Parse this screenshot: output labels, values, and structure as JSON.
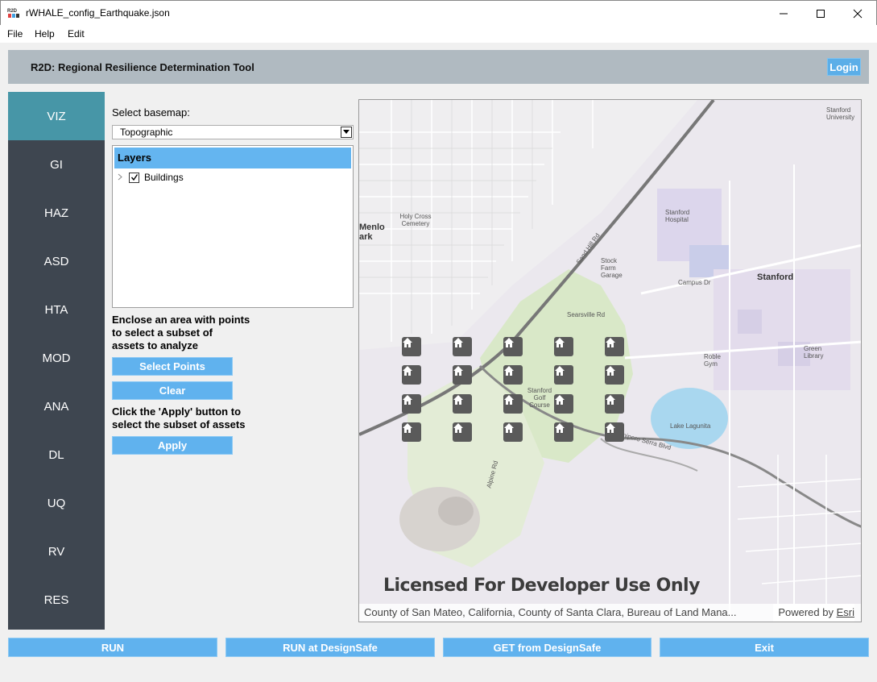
{
  "window": {
    "title": "rWHALE_config_Earthquake.json",
    "app_icon": "r2d-app-icon",
    "minimize_icon": "minimize-icon",
    "maximize_icon": "maximize-icon",
    "close_icon": "close-icon"
  },
  "menu": {
    "items": [
      "File",
      "Help",
      "Edit"
    ]
  },
  "header": {
    "title": "R2D: Regional Resilience Determination Tool",
    "login_label": "Login"
  },
  "sidebar": {
    "items": [
      {
        "label": "VIZ",
        "active": true
      },
      {
        "label": "GI",
        "active": false
      },
      {
        "label": "HAZ",
        "active": false
      },
      {
        "label": "ASD",
        "active": false
      },
      {
        "label": "HTA",
        "active": false
      },
      {
        "label": "MOD",
        "active": false
      },
      {
        "label": "ANA",
        "active": false
      },
      {
        "label": "DL",
        "active": false
      },
      {
        "label": "UQ",
        "active": false
      },
      {
        "label": "RV",
        "active": false
      },
      {
        "label": "RES",
        "active": false
      }
    ]
  },
  "panel": {
    "basemap_label": "Select basemap:",
    "basemap_value": "Topographic",
    "layers_header": "Layers",
    "layers": [
      {
        "label": "Buildings",
        "checked": true
      }
    ],
    "instruction_1": [
      "Enclose an area with points",
      "to select a subset of",
      "assets to analyze"
    ],
    "select_points_label": "Select Points",
    "clear_label": "Clear",
    "instruction_2": [
      "Click the 'Apply' button to",
      "select the subset of assets"
    ],
    "apply_label": "Apply"
  },
  "map": {
    "license_text": "Licensed For Developer Use Only",
    "attribution": "County of San Mateo, California, County of Santa Clara, Bureau of Land Mana...",
    "powered_by": "Powered by",
    "powered_by_link": "Esri",
    "pin_icon": "house-icon",
    "place_labels": {
      "menlo": "Menlo",
      "park": "ark",
      "holy_cross": "Holy Cross Cemetery",
      "stanford": "Stanford",
      "stanford_hospital": "Stanford Hospital",
      "stanford_golf": "Stanford Golf Course",
      "lake_lagunita": "Lake Lagunita",
      "sand_hill": "Sand Hill Rd",
      "junipero": "Junipero Serra Blvd",
      "stanford_univ": "Stanford University",
      "stock_farm": "Stock Farm Garage",
      "roble_gym": "Roble Gym",
      "green_library": "Green Library",
      "campus_dr": "Campus Dr",
      "searsville": "Searsville Rd",
      "alpine": "Alpine Rd"
    }
  },
  "footer": {
    "run_label": "RUN",
    "run_designsafe_label": "RUN at DesignSafe",
    "get_designsafe_label": "GET from DesignSafe",
    "exit_label": "Exit"
  }
}
